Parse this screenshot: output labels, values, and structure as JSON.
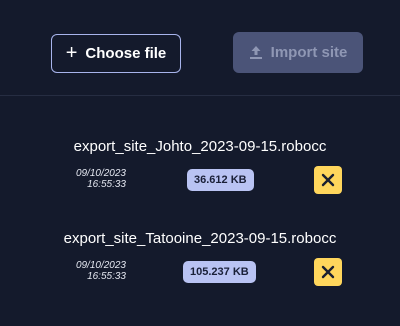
{
  "toolbar": {
    "choose_label": "Choose file",
    "import_label": "Import site"
  },
  "files": [
    {
      "name": "export_site_Johto_2023-09-15.robocc",
      "date": "09/10/2023",
      "time": "16:55:33",
      "size": "36.612 KB"
    },
    {
      "name": "export_site_Tatooine_2023-09-15.robocc",
      "date": "09/10/2023",
      "time": "16:55:33",
      "size": "105.237 KB"
    }
  ],
  "colors": {
    "background": "#141a2c",
    "accent_outline": "#a8b4ec",
    "disabled_button": "#4b5478",
    "size_badge": "#b9c3f3",
    "remove_button": "#ffd65c"
  },
  "icons": {
    "choose": "plus-icon",
    "import": "upload-icon",
    "remove": "close-icon"
  }
}
